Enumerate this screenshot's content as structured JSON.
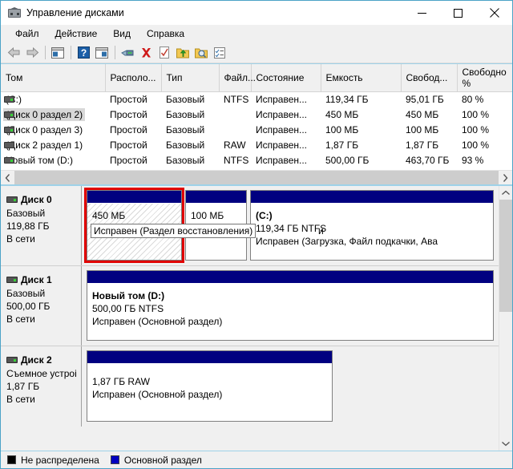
{
  "window": {
    "title": "Управление дисками",
    "icon": "disk-management-icon",
    "controls": {
      "minimize": "–",
      "maximize": "□",
      "close": "✕"
    }
  },
  "menu": {
    "items": [
      "Файл",
      "Действие",
      "Вид",
      "Справка"
    ]
  },
  "toolbar": {
    "buttons": [
      "back-arrow-icon",
      "forward-arrow-icon",
      "show-console-tree-icon",
      "help-icon",
      "show-action-pane-icon",
      "disk-icon",
      "delete-icon",
      "properties-check-icon",
      "folder-up-icon",
      "folder-search-icon",
      "properties-icon"
    ]
  },
  "volume_list": {
    "columns": [
      "Том",
      "Располо...",
      "Тип",
      "Файл...",
      "Состояние",
      "Емкость",
      "Свобод...",
      "Свободно %"
    ],
    "rows": [
      {
        "name": "(C:)",
        "layout": "Простой",
        "type": "Базовый",
        "fs": "NTFS",
        "status": "Исправен...",
        "capacity": "119,34 ГБ",
        "free": "95,01 ГБ",
        "free_pct": "80 %",
        "selected": false,
        "led": true
      },
      {
        "name": "(Диск 0 раздел 2)",
        "layout": "Простой",
        "type": "Базовый",
        "fs": "",
        "status": "Исправен...",
        "capacity": "450 МБ",
        "free": "450 МБ",
        "free_pct": "100 %",
        "selected": true,
        "led": true
      },
      {
        "name": "(Диск 0 раздел 3)",
        "layout": "Простой",
        "type": "Базовый",
        "fs": "",
        "status": "Исправен...",
        "capacity": "100 МБ",
        "free": "100 МБ",
        "free_pct": "100 %",
        "selected": false,
        "led": true
      },
      {
        "name": "(Диск 2 раздел 1)",
        "layout": "Простой",
        "type": "Базовый",
        "fs": "RAW",
        "status": "Исправен...",
        "capacity": "1,87 ГБ",
        "free": "1,87 ГБ",
        "free_pct": "100 %",
        "selected": false,
        "led": false
      },
      {
        "name": "Новый том (D:)",
        "layout": "Простой",
        "type": "Базовый",
        "fs": "NTFS",
        "status": "Исправен...",
        "capacity": "500,00 ГБ",
        "free": "463,70 ГБ",
        "free_pct": "93 %",
        "selected": false,
        "led": true
      }
    ]
  },
  "graphical_view": {
    "disks": [
      {
        "title": "Диск 0",
        "line1": "Базовый",
        "line2": "119,88 ГБ",
        "line3": "В сети",
        "partitions": [
          {
            "label": "",
            "size": "450 МБ",
            "status": "Исправен (Раздел восстановления)",
            "selected": true,
            "hatched": true
          },
          {
            "label": "",
            "size": "100 МБ",
            "status": "Исправен (Раздел ...)",
            "hatched": false,
            "selected": false
          },
          {
            "label": "(C:)",
            "size": "119,34 ГБ NTFS",
            "status": "Исправен (Загрузка, Файл подкачки, Ава",
            "hatched": false,
            "selected": false
          }
        ]
      },
      {
        "title": "Диск 1",
        "line1": "Базовый",
        "line2": "500,00 ГБ",
        "line3": "В сети",
        "partitions": [
          {
            "label": "Новый том  (D:)",
            "size": "500,00 ГБ NTFS",
            "status": "Исправен (Основной раздел)",
            "hatched": false,
            "selected": false
          }
        ]
      },
      {
        "title": "Диск 2",
        "line1": "Съемное устроі",
        "line2": "1,87 ГБ",
        "line3": "В сети",
        "partitions": [
          {
            "label": "",
            "size": "1,87 ГБ RAW",
            "status": "Исправен (Основной раздел)",
            "hatched": false,
            "selected": false
          }
        ]
      }
    ],
    "tooltip": "Исправен (Раздел восстановления)"
  },
  "legend": {
    "items": [
      {
        "label": "Не распределена",
        "color": "#000000"
      },
      {
        "label": "Основной раздел",
        "color": "#0000c0"
      }
    ]
  },
  "colors": {
    "partition_bar": "#000080",
    "selection_outline": "#e00000",
    "window_border": "#4ba3c7",
    "row_highlight": "#d8d8d8"
  }
}
